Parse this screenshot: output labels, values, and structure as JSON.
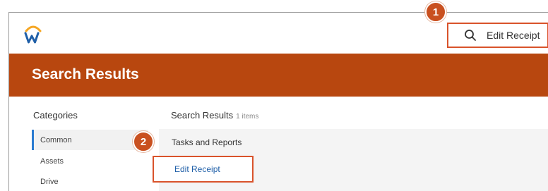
{
  "search": {
    "query": "Edit Receipt"
  },
  "header": {
    "title": "Search Results"
  },
  "categories": {
    "title": "Categories",
    "items": [
      {
        "label": "Common"
      },
      {
        "label": "Assets"
      },
      {
        "label": "Drive"
      }
    ]
  },
  "results": {
    "heading": "Search Results",
    "count": "1 items",
    "group_title": "Tasks and Reports",
    "items": [
      {
        "label": "Edit Receipt"
      }
    ]
  },
  "annotations": {
    "step1": "1",
    "step2": "2"
  },
  "colors": {
    "brand_band": "#b8470f",
    "highlight_box": "#d9532b",
    "link": "#1f5fa8",
    "active_marker": "#2a7bd1"
  },
  "icons": {
    "logo": "workday-logo",
    "search": "search-icon"
  }
}
